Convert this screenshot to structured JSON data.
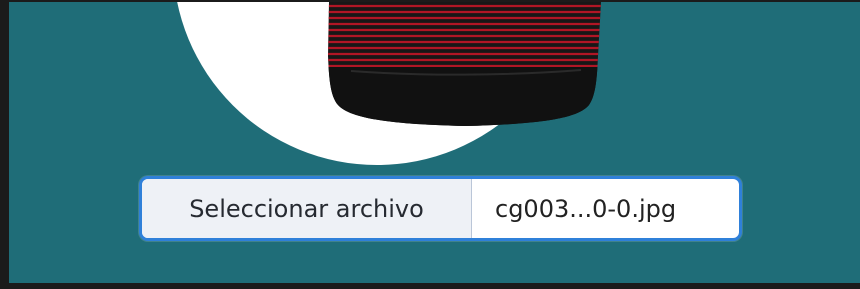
{
  "upload": {
    "button_label": "Seleccionar archivo",
    "file_name": "cg003...0-0.jpg"
  },
  "colors": {
    "background": "#1f6d78",
    "circle": "#ffffff",
    "input_border": "#2f80d9",
    "button_background": "#eef1f6"
  },
  "image": {
    "name": "product-image",
    "subject": "black and red striped shirt"
  }
}
